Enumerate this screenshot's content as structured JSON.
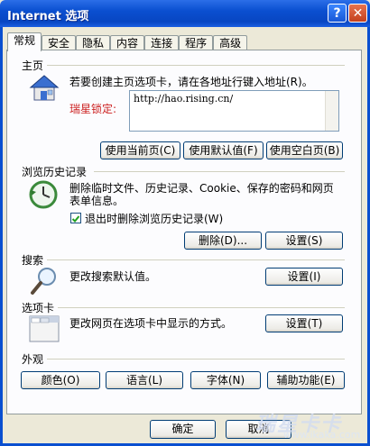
{
  "window": {
    "title": "Internet 选项",
    "help_label": "?",
    "close_label": "✕"
  },
  "tabs": [
    {
      "label": "常规"
    },
    {
      "label": "安全"
    },
    {
      "label": "隐私"
    },
    {
      "label": "内容"
    },
    {
      "label": "连接"
    },
    {
      "label": "程序"
    },
    {
      "label": "高级"
    }
  ],
  "home": {
    "section_title": "主页",
    "description": "若要创建主页选项卡，请在各地址行键入地址(R)。",
    "lock_label": "瑞星锁定:",
    "url": "http://hao.rising.cn/",
    "btn_current": "使用当前页(C)",
    "btn_default": "使用默认值(F)",
    "btn_blank": "使用空白页(B)"
  },
  "history": {
    "section_title": "浏览历史记录",
    "description_line1": "删除临时文件、历史记录、Cookie、保存的密码和网页",
    "description_line2": "表单信息。",
    "checkbox_label": "退出时删除浏览历史记录(W)",
    "checkbox_checked": true,
    "btn_delete": "删除(D)...",
    "btn_settings": "设置(S)"
  },
  "search": {
    "section_title": "搜索",
    "description": "更改搜索默认值。",
    "btn_settings": "设置(I)"
  },
  "tabs_section": {
    "section_title": "选项卡",
    "description": "更改网页在选项卡中显示的方式。",
    "btn_settings": "设置(T)"
  },
  "appearance": {
    "section_title": "外观",
    "btn_colors": "颜色(O)",
    "btn_languages": "语言(L)",
    "btn_fonts": "字体(N)",
    "btn_accessibility": "辅助功能(E)"
  },
  "footer": {
    "ok": "确定",
    "cancel": "取消"
  },
  "watermark": {
    "brand": "瑞星卡卡",
    "url": "www.ikaka.com"
  }
}
